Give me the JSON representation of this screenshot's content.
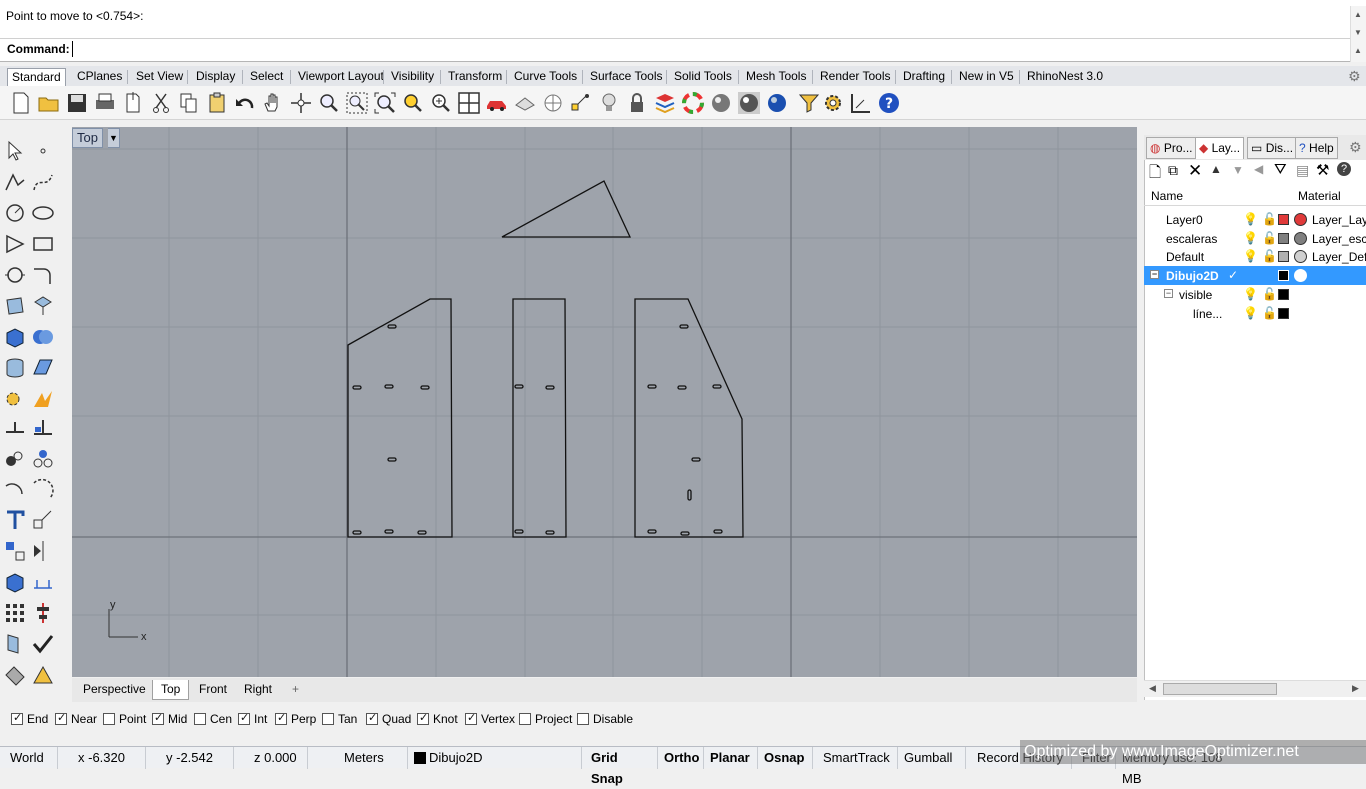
{
  "command": {
    "history": "Point to move to <0.754>:",
    "label": "Command:",
    "input_value": ""
  },
  "tabs": [
    "Standard",
    "CPlanes",
    "Set View",
    "Display",
    "Select",
    "Viewport Layout",
    "Visibility",
    "Transform",
    "Curve Tools",
    "Surface Tools",
    "Solid Tools",
    "Mesh Tools",
    "Render Tools",
    "Drafting",
    "New in V5",
    "RhinoNest 3.0"
  ],
  "viewport": {
    "title": "Top",
    "axis_x": "x",
    "axis_y": "y",
    "tabs": [
      "Perspective",
      "Top",
      "Front",
      "Right"
    ],
    "add_tab": "+"
  },
  "panel": {
    "tabs": [
      "Pro...",
      "Lay...",
      "Dis...",
      "Help"
    ],
    "col_name": "Name",
    "col_material": "Material",
    "layers": [
      {
        "name": "Layer0",
        "material": "Layer_Lay...",
        "color": "#e03a3a",
        "mat_color": "#e03a3a"
      },
      {
        "name": "escaleras",
        "material": "Layer_esc...",
        "color": "#808080",
        "mat_color": "#808080"
      },
      {
        "name": "Default",
        "material": "Layer_Def...",
        "color": "#b0b0b0",
        "mat_color": "#d0d0d0"
      },
      {
        "name": "Dibujo2D",
        "material": "",
        "color": "#000000",
        "mat_color": "#ffffff",
        "check": "✓"
      },
      {
        "name": "visible",
        "material": "",
        "color": "#000000"
      },
      {
        "name": "líne...",
        "material": "",
        "color": "#000000"
      }
    ]
  },
  "osnap": [
    {
      "label": "End",
      "on": true
    },
    {
      "label": "Near",
      "on": true
    },
    {
      "label": "Point",
      "on": false
    },
    {
      "label": "Mid",
      "on": true
    },
    {
      "label": "Cen",
      "on": false
    },
    {
      "label": "Int",
      "on": true
    },
    {
      "label": "Perp",
      "on": true
    },
    {
      "label": "Tan",
      "on": false
    },
    {
      "label": "Quad",
      "on": true
    },
    {
      "label": "Knot",
      "on": true
    },
    {
      "label": "Vertex",
      "on": true
    },
    {
      "label": "Project",
      "on": false
    },
    {
      "label": "Disable",
      "on": false
    }
  ],
  "status": {
    "cplane": "World",
    "x": "x -6.320",
    "y": "y -2.542",
    "z": "z 0.000",
    "units": "Meters",
    "layer": "Dibujo2D",
    "grid_snap": "Grid Snap",
    "ortho": "Ortho",
    "planar": "Planar",
    "osnap": "Osnap",
    "smarttrack": "SmartTrack",
    "gumball": "Gumball",
    "record_history": "Record History",
    "filter": "Filter",
    "memory": "Memory use: 108 MB"
  },
  "watermark": "Optimized by www.ImageOptimizer.net"
}
